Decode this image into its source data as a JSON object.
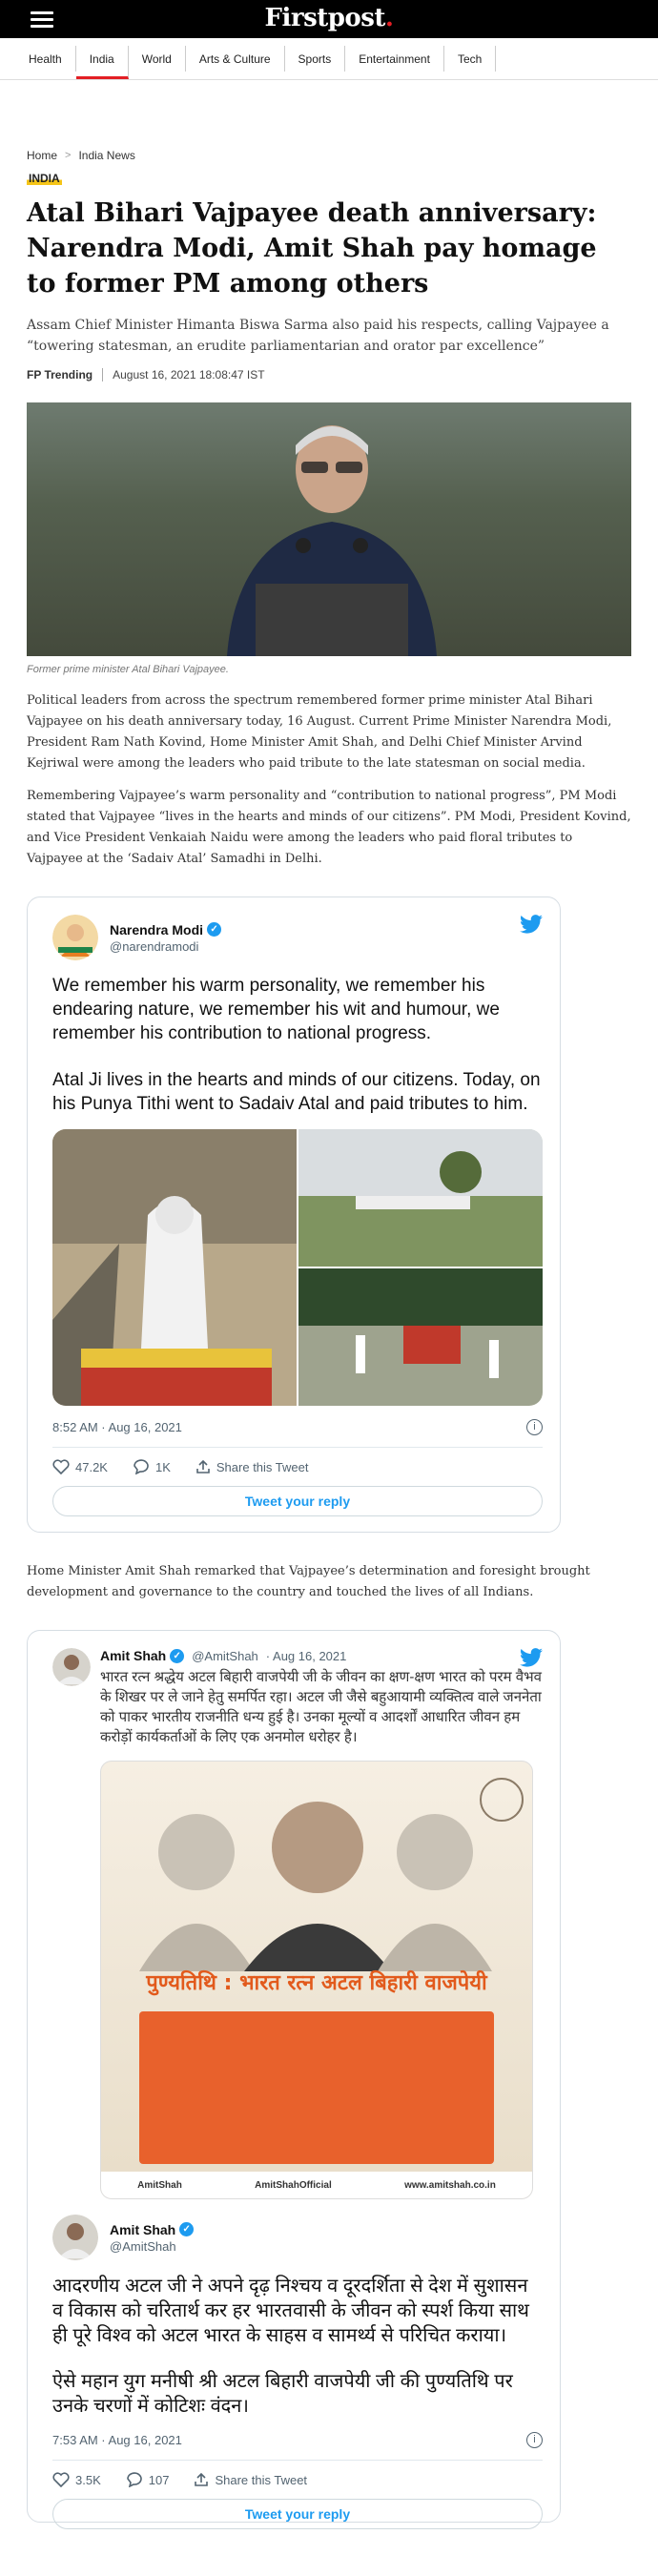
{
  "header": {
    "logo_text": "Firstpost",
    "logo_dot": ".",
    "nav": [
      "Health",
      "India",
      "World",
      "Arts & Culture",
      "Sports",
      "Entertainment",
      "Tech"
    ],
    "active_nav": "India"
  },
  "breadcrumb": {
    "home": "Home",
    "sep": ">",
    "section": "India News"
  },
  "article": {
    "section_tag": "INDIA",
    "headline": "Atal Bihari Vajpayee death anniversary: Narendra Modi, Amit Shah pay homage to former PM among others",
    "subhead": "Assam Chief Minister Himanta Biswa Sarma also paid his respects, calling Vajpayee a “towering statesman, an erudite parliamentarian and orator par excellence”",
    "author": "FP Trending",
    "date": "August 16, 2021 18:08:47 IST",
    "image_caption": "Former prime minister Atal Bihari Vajpayee.",
    "paragraph_1": "Political leaders from across the spectrum remembered former prime minister Atal Bihari Vajpayee on his death anniversary today, 16 August. Current Prime Minister Narendra Modi, President Ram Nath Kovind, Home Minister Amit Shah, and Delhi Chief Minister Arvind Kejriwal were among the leaders who paid tribute to the late statesman on social media.",
    "paragraph_2": "Remembering Vajpayee’s warm personality and “contribution to national progress”, PM Modi stated that Vajpayee “lives in the hearts and minds of our citizens”. PM Modi, President Kovind, and Vice President Venkaiah Naidu were among the leaders who paid floral tributes to Vajpayee at the ‘Sadaiv Atal’ Samadhi in Delhi.",
    "paragraph_3": "Home Minister Amit Shah remarked that Vajpayee’s determination and foresight brought development and governance to the country and touched the lives of all Indians."
  },
  "tweet1": {
    "name": "Narendra Modi",
    "handle": "@narendramodi",
    "text_1": "We remember his warm personality, we remember his endearing nature, we remember his wit and humour, we remember his contribution to national progress.",
    "text_2": "Atal Ji lives in the hearts and minds of our citizens. Today, on his Punya Tithi went to Sadaiv Atal and paid tributes to him.",
    "time": "8:52 AM · Aug 16, 2021",
    "likes": "47.2K",
    "replies": "1K",
    "share": "Share this Tweet",
    "reply_button": "Tweet your reply"
  },
  "tweet2": {
    "name": "Amit Shah",
    "handle": "@AmitShah",
    "date_short": "· Aug 16, 2021",
    "quoted_text": "भारत रत्न श्रद्धेय अटल बिहारी वाजपेयी जी के जीवन का क्षण-क्षण भारत को परम वैभव के शिखर पर ले जाने हेतु समर्पित रहा। अटल जी जैसे बहुआयामी व्यक्तित्व वाले जननेता को पाकर भारतीय राजनीति धन्य हुई है। उनका मूल्यों व आदर्शों आधारित जीवन हम करोड़ों कार्यकर्ताओं के लिए एक अनमोल धरोहर है।",
    "poster_title": "पुण्यतिथि : भारत रत्न अटल बिहारी वाजपेयी",
    "poster_footer": [
      "AmitShah",
      "AmitShahOfficial",
      "www.amitshah.co.in"
    ],
    "text_1": "आदरणीय अटल जी ने अपने दृढ़ निश्चय व दूरदर्शिता से देश में सुशासन व विकास को चरितार्थ कर हर भारतवासी के जीवन को स्पर्श किया साथ ही पूरे विश्व को अटल भारत के साहस व सामर्थ्य से परिचित कराया।",
    "text_2": "ऐसे महान युग मनीषी श्री अटल बिहारी वाजपेयी जी की पुण्यतिथि पर उनके चरणों में कोटिशः वंदन।",
    "time": "7:53 AM · Aug 16, 2021",
    "likes": "3.5K",
    "replies": "107",
    "share": "Share this Tweet",
    "reply_button": "Tweet your reply"
  },
  "colors": {
    "accent_red": "#e31e24",
    "twitter_blue": "#1d9bf0",
    "tag_yellow": "#f5c518"
  },
  "icons": [
    "menu-icon",
    "twitter-bird-icon",
    "verified-icon",
    "heart-icon",
    "reply-icon",
    "share-icon",
    "info-icon"
  ]
}
